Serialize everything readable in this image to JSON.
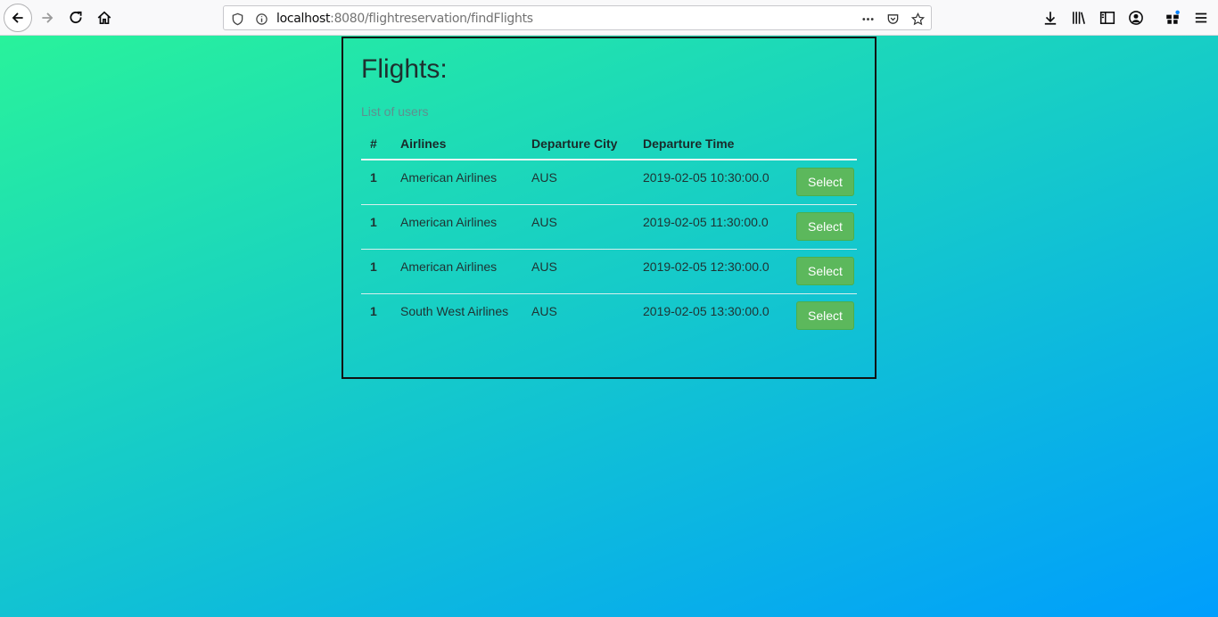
{
  "browser": {
    "url_host": "localhost",
    "url_rest": ":8080/flightreservation/findFlights"
  },
  "page": {
    "title": "Flights:",
    "caption": "List of users",
    "headers": [
      "#",
      "Airlines",
      "Departure City",
      "Departure Time",
      ""
    ],
    "rows": [
      {
        "num": "1",
        "airline": "American Airlines",
        "city": "AUS",
        "time": "2019-02-05 10:30:00.0",
        "action": "Select"
      },
      {
        "num": "1",
        "airline": "American Airlines",
        "city": "AUS",
        "time": "2019-02-05 11:30:00.0",
        "action": "Select"
      },
      {
        "num": "1",
        "airline": "American Airlines",
        "city": "AUS",
        "time": "2019-02-05 12:30:00.0",
        "action": "Select"
      },
      {
        "num": "1",
        "airline": "South West Airlines",
        "city": "AUS",
        "time": "2019-02-05 13:30:00.0",
        "action": "Select"
      }
    ]
  },
  "colors": {
    "gradient_start": "#2af598",
    "gradient_end": "#009efd",
    "select_button": "#5cb85c"
  }
}
